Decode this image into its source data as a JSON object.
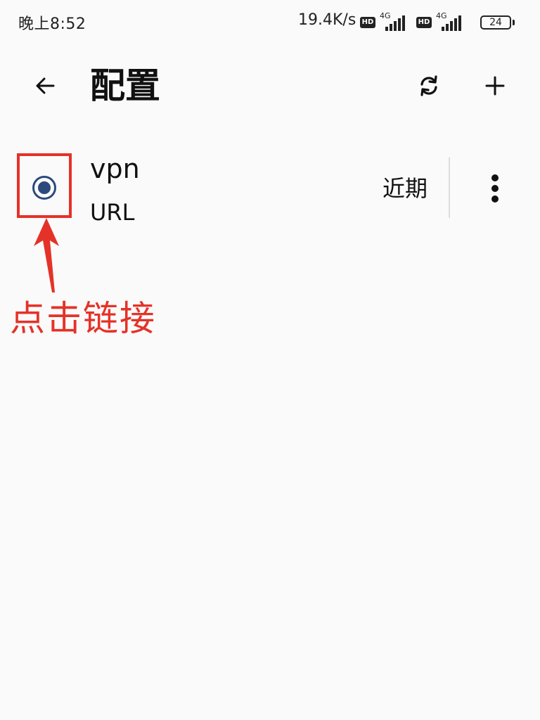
{
  "status_bar": {
    "time": "晚上8:52",
    "net_speed": "19.4K/s",
    "hd_label": "HD",
    "network_type": "4G",
    "battery_level": "24"
  },
  "header": {
    "title": "配置",
    "back_icon": "arrow-left-icon",
    "refresh_icon": "sync-icon",
    "add_icon": "plus-icon"
  },
  "profiles": [
    {
      "name": "vpn",
      "type": "URL",
      "update_label": "近期",
      "selected": true
    }
  ],
  "annotation": {
    "label": "点击链接",
    "color": "#e53228"
  },
  "colors": {
    "background": "#fafafa",
    "radio_accent": "#2c4a7c",
    "annotation_red": "#e53228",
    "text": "#111111"
  }
}
